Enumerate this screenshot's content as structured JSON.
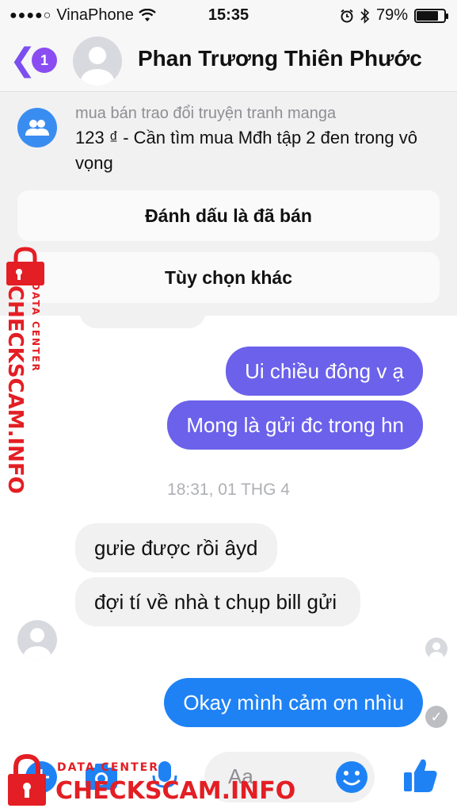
{
  "status_bar": {
    "signal_dots": "●●●●○",
    "carrier": "VinaPhone",
    "time": "15:35",
    "battery_percent": "79%",
    "battery_level": 0.79
  },
  "header": {
    "unread_count": "1",
    "contact_name": "Phan Trương Thiên Phước"
  },
  "listing": {
    "group_name": "mua bán trao đổi truyện tranh manga",
    "title": "123 ₫ - Cần tìm mua Mđh tập 2 đen trong vô vọng",
    "mark_sold_label": "Đánh dấu là đã bán",
    "more_options_label": "Tùy chọn khác"
  },
  "messages": {
    "out_1": "Ui chiều đông v ạ",
    "out_2": "Mong là gửi đc trong hn",
    "timestamp": "18:31, 01 THG 4",
    "in_1": "gưie được rồi âyd",
    "in_2": "đợi tí về nhà t chụp bill gửi",
    "out_3": "Okay mình cảm ơn nhìu"
  },
  "composer": {
    "placeholder": "Aa"
  },
  "watermark": {
    "label": "DATA CENTER",
    "site": "CHECKSCAM.INFO"
  },
  "colors": {
    "accent_purple": "#6b61ea",
    "accent_blue": "#1e82f5",
    "watermark_red": "#e31e24"
  }
}
